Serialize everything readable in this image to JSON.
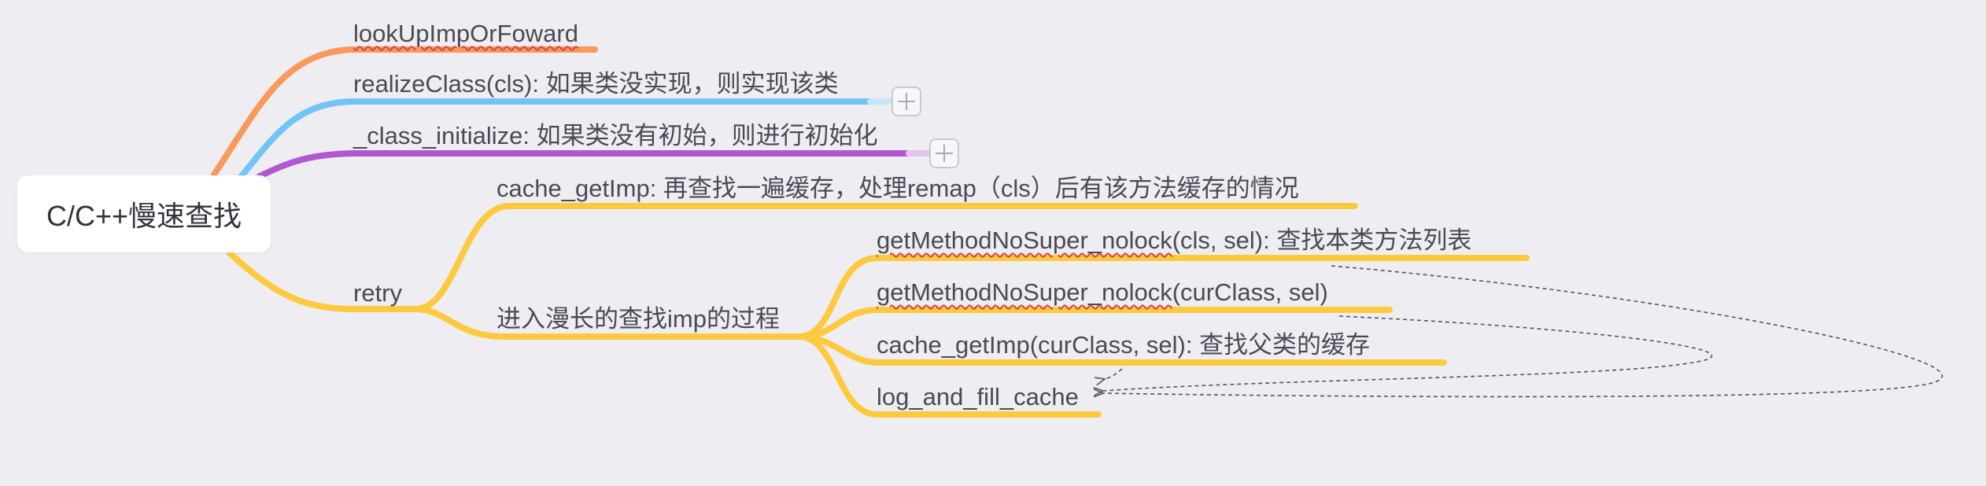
{
  "colors": {
    "background": "#ededf2",
    "orange": "#f99a5c",
    "blue": "#72c4f6",
    "purple": "#b157d1",
    "yellow": "#fdca3f",
    "text": "#4a4a55",
    "arrow": "#555560"
  },
  "root": {
    "label": "C/C++慢速查找"
  },
  "branches": {
    "lookup": {
      "label": "lookUpImpOrFoward"
    },
    "realize": {
      "label": "realizeClass(cls): 如果类没实现，则实现该类",
      "collapsed": true
    },
    "initialize": {
      "label": "_class_initialize: 如果类没有初始，则进行初始化",
      "collapsed": true
    },
    "retry": {
      "label": "retry",
      "cache": {
        "label": "cache_getImp: 再查找一遍缓存，处理remap（cls）后有该方法缓存的情况"
      },
      "slow": {
        "label": "进入漫长的查找imp的过程",
        "method_list": {
          "label_a": "getMethodNoSuper_nolock",
          "label_b": "(cls, sel): 查找本类方法列表"
        },
        "method_super": {
          "label_a": "getMethodNoSuper_nolock",
          "label_b": "(curClass, sel)"
        },
        "super_cache": {
          "label": "cache_getImp(curClass, sel): 查找父类的缓存"
        },
        "fill_cache": {
          "label": "log_and_fill_cache"
        }
      }
    }
  },
  "expand_icon": "plus-icon"
}
